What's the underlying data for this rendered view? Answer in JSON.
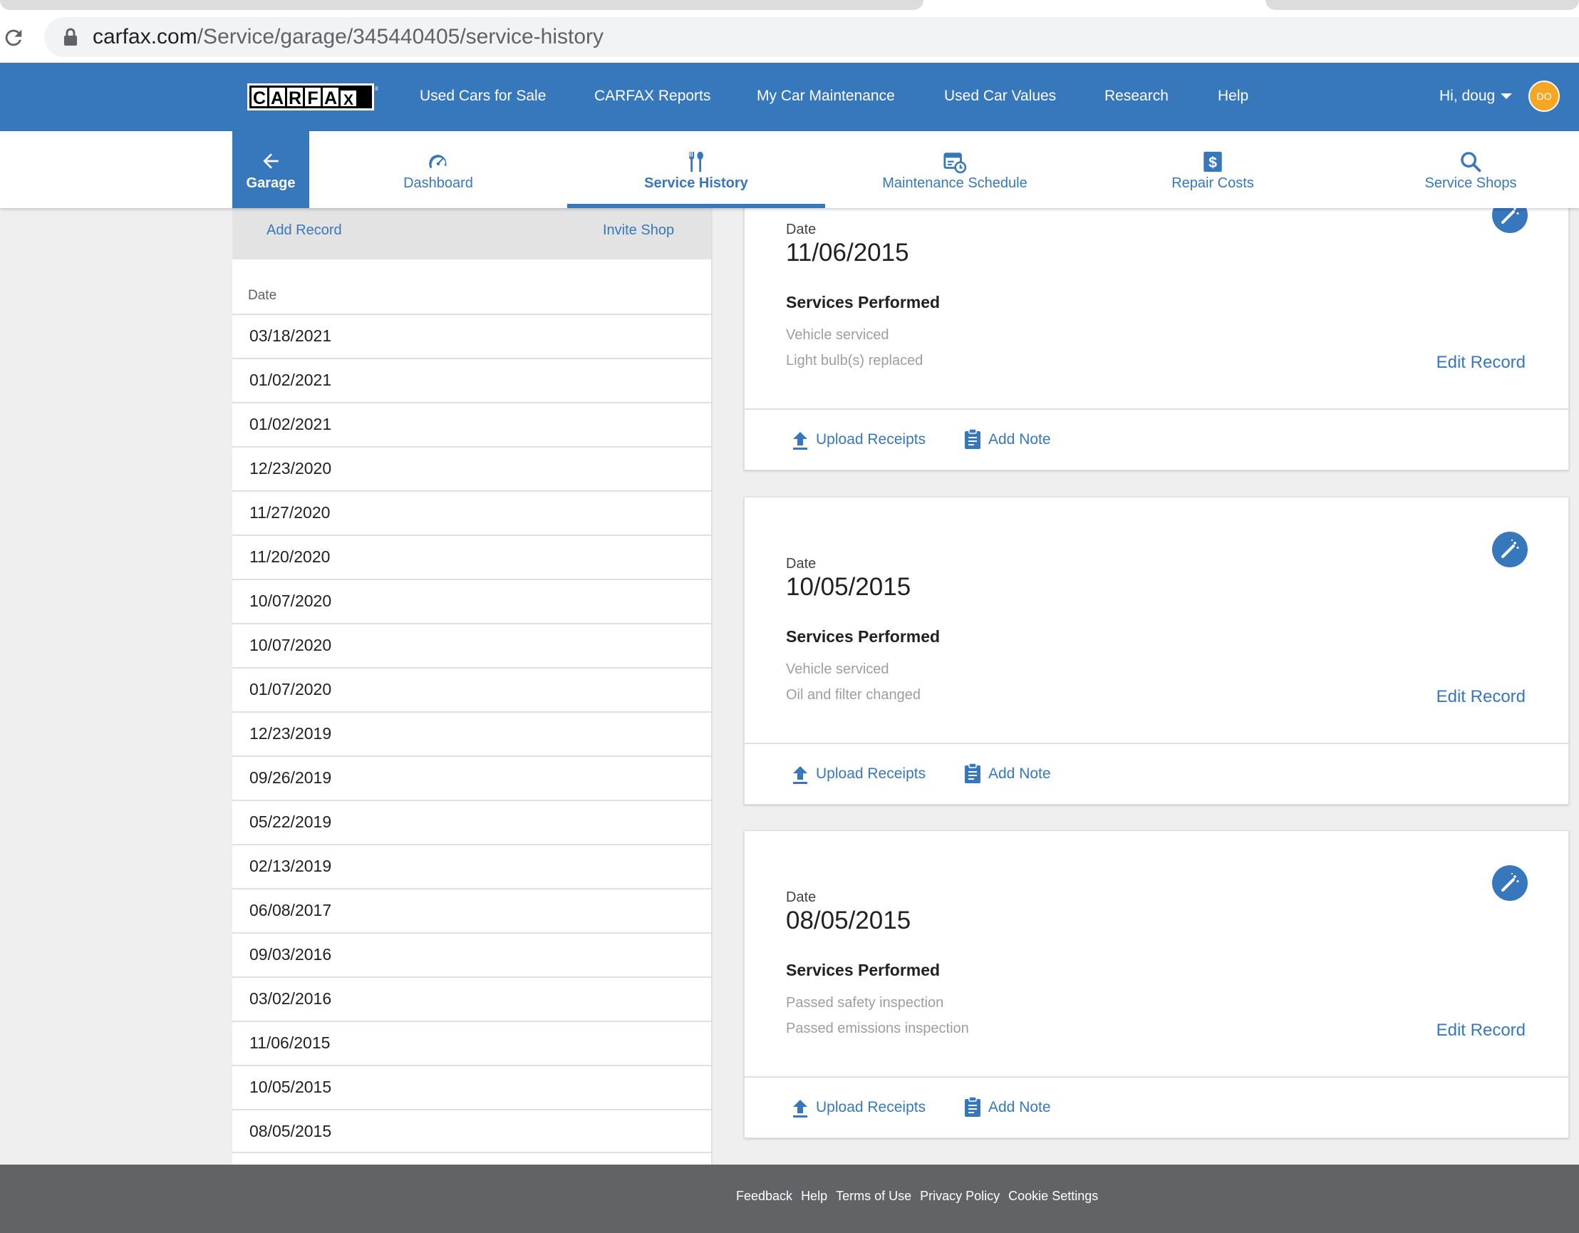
{
  "browser": {
    "url_host": "carfax.com",
    "url_path": "/Service/garage/345440405/service-history"
  },
  "topnav": {
    "logo_text": "CARFAX",
    "links": [
      "Used Cars for Sale",
      "CARFAX Reports",
      "My Car Maintenance",
      "Used Car Values",
      "Research",
      "Help"
    ],
    "greeting": "Hi, doug",
    "avatar_initials": "DO"
  },
  "subnav": {
    "garage_label": "Garage",
    "tabs": [
      {
        "label": "Dashboard",
        "icon": "speedometer-icon"
      },
      {
        "label": "Service History",
        "icon": "tools-icon",
        "active": true
      },
      {
        "label": "Maintenance Schedule",
        "icon": "calendar-clock-icon"
      },
      {
        "label": "Repair Costs",
        "icon": "dollar-icon"
      },
      {
        "label": "Service Shops",
        "icon": "search-icon"
      }
    ]
  },
  "left": {
    "add_record": "Add Record",
    "invite_shop": "Invite Shop",
    "date_header": "Date",
    "dates": [
      "03/18/2021",
      "01/02/2021",
      "01/02/2021",
      "12/23/2020",
      "11/27/2020",
      "11/20/2020",
      "10/07/2020",
      "10/07/2020",
      "01/07/2020",
      "12/23/2019",
      "09/26/2019",
      "05/22/2019",
      "02/13/2019",
      "06/08/2017",
      "09/03/2016",
      "03/02/2016",
      "11/06/2015",
      "10/05/2015",
      "08/05/2015"
    ]
  },
  "records": [
    {
      "date_label": "Date",
      "date": "11/06/2015",
      "services_heading": "Services Performed",
      "services": [
        "Vehicle serviced",
        "Light bulb(s) replaced"
      ],
      "edit": "Edit Record",
      "upload": "Upload Receipts",
      "note": "Add Note"
    },
    {
      "date_label": "Date",
      "date": "10/05/2015",
      "services_heading": "Services Performed",
      "services": [
        "Vehicle serviced",
        "Oil and filter changed"
      ],
      "edit": "Edit Record",
      "upload": "Upload Receipts",
      "note": "Add Note"
    },
    {
      "date_label": "Date",
      "date": "08/05/2015",
      "services_heading": "Services Performed",
      "services": [
        "Passed safety inspection",
        "Passed emissions inspection"
      ],
      "edit": "Edit Record",
      "upload": "Upload Receipts",
      "note": "Add Note"
    }
  ],
  "footer": {
    "links": [
      "Feedback",
      "Help",
      "Terms of Use",
      "Privacy Policy",
      "Cookie Settings"
    ]
  },
  "colors": {
    "brand_blue": "#3777bc",
    "footer_gray": "#616366",
    "avatar_orange": "#f5a623"
  }
}
